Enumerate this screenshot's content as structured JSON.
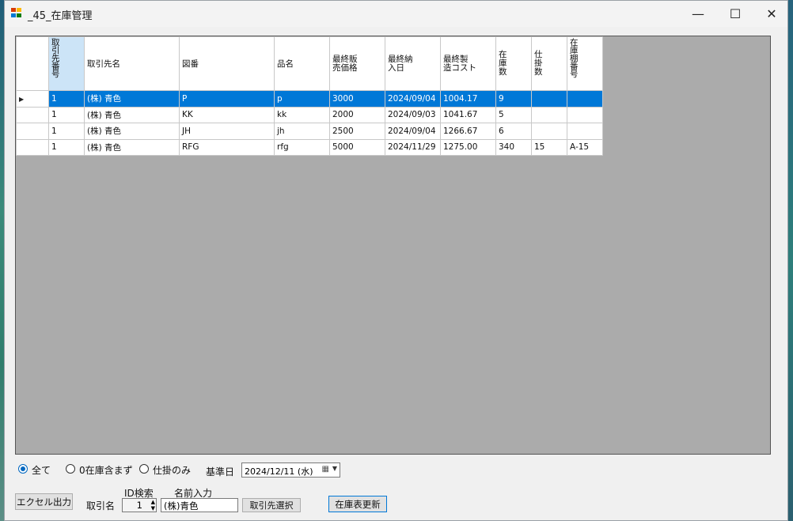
{
  "window": {
    "title": "_45_在庫管理",
    "min_glyph": "—",
    "max_glyph": "☐",
    "close_glyph": "✕"
  },
  "grid": {
    "columns": [
      "取引先番号",
      "取引先名",
      "図番",
      "品名",
      "最終販売価格",
      "最終納入日",
      "最終製造コスト",
      "在庫数",
      "仕掛数",
      "在庫棚番号"
    ],
    "header_display": [
      "取\n引\n先\n番\n号",
      "取引先名",
      "図番",
      "品名",
      "最終販\n売価格",
      "最終納\n入日",
      "最終製\n造コスト",
      "在\n庫\n数",
      "仕\n掛\n数",
      "在\n庫\n棚\n番\n号"
    ],
    "rows": [
      [
        "1",
        "(株) 青色",
        "P",
        "p",
        "3000",
        "2024/09/04",
        "1004.17",
        "9",
        "",
        ""
      ],
      [
        "1",
        "(株) 青色",
        "KK",
        "kk",
        "2000",
        "2024/09/03",
        "1041.67",
        "5",
        "",
        ""
      ],
      [
        "1",
        "(株) 青色",
        "JH",
        "jh",
        "2500",
        "2024/09/04",
        "1266.67",
        "6",
        "",
        ""
      ],
      [
        "1",
        "(株) 青色",
        "RFG",
        "rfg",
        "5000",
        "2024/11/29",
        "1275.00",
        "340",
        "15",
        "A-15"
      ]
    ],
    "current_row_marker": "▶"
  },
  "filter": {
    "options": [
      "全て",
      "0在庫含まず",
      "仕掛のみ"
    ],
    "selected": "全て",
    "date_label": "基準日",
    "date_value": "2024/12/11 (水)"
  },
  "bottom": {
    "excel_button": "エクセル出力",
    "torihiki_label": "取引名",
    "id_search_label": "ID検索",
    "id_value": "1",
    "name_input_label": "名前入力",
    "name_value": "(株)青色",
    "select_button": "取引先選択",
    "update_button": "在庫表更新"
  }
}
